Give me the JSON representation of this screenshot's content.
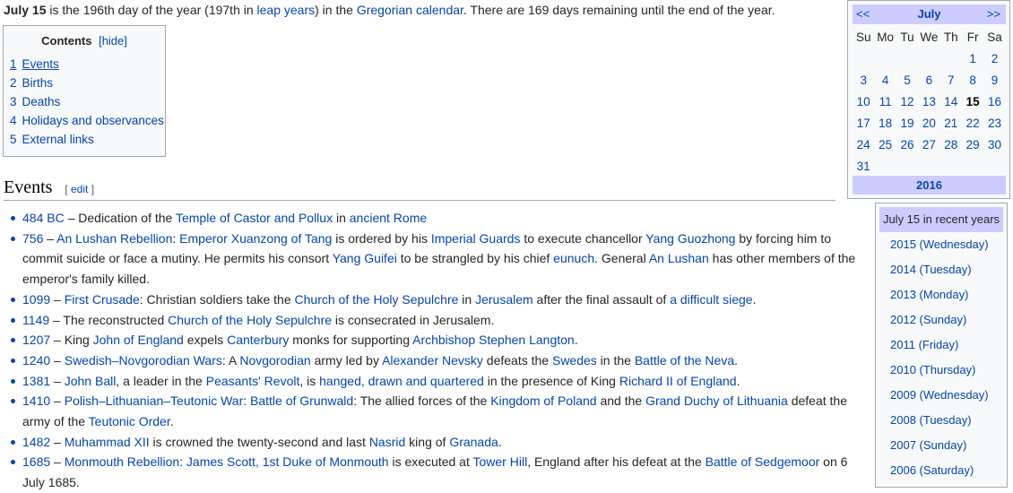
{
  "intro": {
    "bold": "July 15",
    "t1": " is the 196th day of the year (197th in ",
    "leap": "leap years",
    "t2": ") in the ",
    "greg": "Gregorian calendar",
    "t3": ". There are 169 days remaining until the end of the year."
  },
  "toc": {
    "title": "Contents",
    "hide": "[hide]",
    "items": [
      {
        "num": "1",
        "label": "Events"
      },
      {
        "num": "2",
        "label": "Births"
      },
      {
        "num": "3",
        "label": "Deaths"
      },
      {
        "num": "4",
        "label": "Holidays and observances"
      },
      {
        "num": "5",
        "label": "External links"
      }
    ]
  },
  "events_heading": {
    "title": "Events",
    "edit_open": "[ ",
    "edit": "edit",
    "edit_close": " ]"
  },
  "events": [
    [
      {
        "t": "484 BC",
        "l": 1
      },
      {
        "t": " – Dedication of the "
      },
      {
        "t": "Temple of Castor and Pollux",
        "l": 1
      },
      {
        "t": " in "
      },
      {
        "t": "ancient Rome",
        "l": 1
      }
    ],
    [
      {
        "t": "756",
        "l": 1
      },
      {
        "t": " – "
      },
      {
        "t": "An Lushan Rebellion",
        "l": 1
      },
      {
        "t": ": "
      },
      {
        "t": "Emperor Xuanzong of Tang",
        "l": 1
      },
      {
        "t": " is ordered by his "
      },
      {
        "t": "Imperial Guards",
        "l": 1
      },
      {
        "t": " to execute chancellor "
      },
      {
        "t": "Yang Guozhong",
        "l": 1
      },
      {
        "t": " by forcing him to commit suicide or face a mutiny. He permits his consort "
      },
      {
        "t": "Yang Guifei",
        "l": 1
      },
      {
        "t": " to be strangled by his chief "
      },
      {
        "t": "eunuch",
        "l": 1
      },
      {
        "t": ". General "
      },
      {
        "t": "An Lushan",
        "l": 1
      },
      {
        "t": " has other members of the emperor's family killed."
      }
    ],
    [
      {
        "t": "1099",
        "l": 1
      },
      {
        "t": " – "
      },
      {
        "t": "First Crusade",
        "l": 1
      },
      {
        "t": ": Christian soldiers take the "
      },
      {
        "t": "Church of the Holy Sepulchre",
        "l": 1
      },
      {
        "t": " in "
      },
      {
        "t": "Jerusalem",
        "l": 1
      },
      {
        "t": " after the final assault of "
      },
      {
        "t": "a difficult siege",
        "l": 1
      },
      {
        "t": "."
      }
    ],
    [
      {
        "t": "1149",
        "l": 1
      },
      {
        "t": " – The reconstructed "
      },
      {
        "t": "Church of the Holy Sepulchre",
        "l": 1
      },
      {
        "t": " is consecrated in Jerusalem."
      }
    ],
    [
      {
        "t": "1207",
        "l": 1
      },
      {
        "t": " – King "
      },
      {
        "t": "John of England",
        "l": 1
      },
      {
        "t": " expels "
      },
      {
        "t": "Canterbury",
        "l": 1
      },
      {
        "t": " monks for supporting "
      },
      {
        "t": "Archbishop Stephen Langton",
        "l": 1
      },
      {
        "t": "."
      }
    ],
    [
      {
        "t": "1240",
        "l": 1
      },
      {
        "t": " – "
      },
      {
        "t": "Swedish–Novgorodian Wars",
        "l": 1
      },
      {
        "t": ": A "
      },
      {
        "t": "Novgorodian",
        "l": 1
      },
      {
        "t": " army led by "
      },
      {
        "t": "Alexander Nevsky",
        "l": 1
      },
      {
        "t": " defeats the "
      },
      {
        "t": "Swedes",
        "l": 1
      },
      {
        "t": " in the "
      },
      {
        "t": "Battle of the Neva",
        "l": 1
      },
      {
        "t": "."
      }
    ],
    [
      {
        "t": "1381",
        "l": 1
      },
      {
        "t": " – "
      },
      {
        "t": "John Ball",
        "l": 1
      },
      {
        "t": ", a leader in the "
      },
      {
        "t": "Peasants' Revolt",
        "l": 1
      },
      {
        "t": ", is "
      },
      {
        "t": "hanged, drawn and quartered",
        "l": 1
      },
      {
        "t": " in the presence of King "
      },
      {
        "t": "Richard II of England",
        "l": 1
      },
      {
        "t": "."
      }
    ],
    [
      {
        "t": "1410",
        "l": 1
      },
      {
        "t": " – "
      },
      {
        "t": "Polish–Lithuanian–Teutonic War",
        "l": 1
      },
      {
        "t": ": "
      },
      {
        "t": "Battle of Grunwald",
        "l": 1
      },
      {
        "t": ": The allied forces of the "
      },
      {
        "t": "Kingdom of Poland",
        "l": 1
      },
      {
        "t": " and the "
      },
      {
        "t": "Grand Duchy of Lithuania",
        "l": 1
      },
      {
        "t": " defeat the army of the "
      },
      {
        "t": "Teutonic Order",
        "l": 1
      },
      {
        "t": "."
      }
    ],
    [
      {
        "t": "1482",
        "l": 1
      },
      {
        "t": " – "
      },
      {
        "t": "Muhammad XII",
        "l": 1
      },
      {
        "t": " is crowned the twenty-second and last "
      },
      {
        "t": "Nasrid",
        "l": 1
      },
      {
        "t": " king of "
      },
      {
        "t": "Granada",
        "l": 1
      },
      {
        "t": "."
      }
    ],
    [
      {
        "t": "1685",
        "l": 1
      },
      {
        "t": " – "
      },
      {
        "t": "Monmouth Rebellion",
        "l": 1
      },
      {
        "t": ": "
      },
      {
        "t": "James Scott, 1st Duke of Monmouth",
        "l": 1
      },
      {
        "t": " is executed at "
      },
      {
        "t": "Tower Hill",
        "l": 1
      },
      {
        "t": ", England after his defeat at the "
      },
      {
        "t": "Battle of Sedgemoor",
        "l": 1
      },
      {
        "t": " on 6 July 1685."
      }
    ]
  ],
  "calendar": {
    "prev": "<<",
    "month": "July",
    "next": ">>",
    "weekdays": [
      "Su",
      "Mo",
      "Tu",
      "We",
      "Th",
      "Fr",
      "Sa"
    ],
    "weeks": [
      [
        "",
        "",
        "",
        "",
        "",
        "1",
        "2"
      ],
      [
        "3",
        "4",
        "5",
        "6",
        "7",
        "8",
        "9"
      ],
      [
        "10",
        "11",
        "12",
        "13",
        "14",
        "15",
        "16"
      ],
      [
        "17",
        "18",
        "19",
        "20",
        "21",
        "22",
        "23"
      ],
      [
        "24",
        "25",
        "26",
        "27",
        "28",
        "29",
        "30"
      ],
      [
        "31",
        "",
        "",
        "",
        "",
        "",
        ""
      ]
    ],
    "today": "15",
    "year": "2016"
  },
  "recent": {
    "title": "July 15 in recent years",
    "items": [
      "2015 (Wednesday)",
      "2014 (Tuesday)",
      "2013 (Monday)",
      "2012 (Sunday)",
      "2011 (Friday)",
      "2010 (Thursday)",
      "2009 (Wednesday)",
      "2008 (Tuesday)",
      "2007 (Sunday)",
      "2006 (Saturday)"
    ]
  }
}
